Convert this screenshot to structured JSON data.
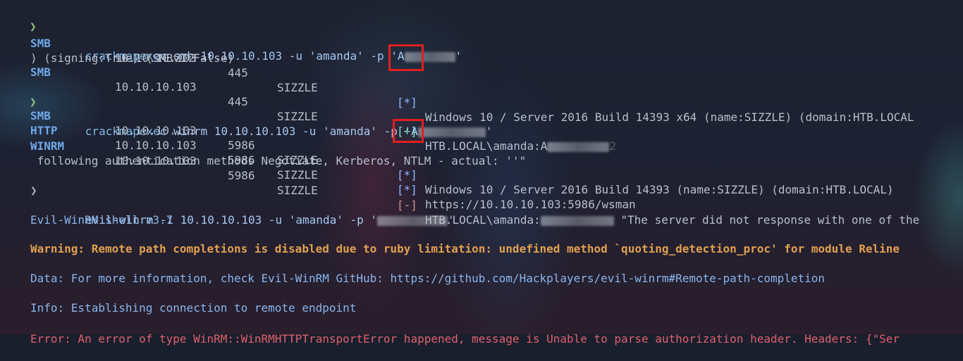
{
  "terminal": {
    "prompt_symbol": "❯",
    "blocks": {
      "smb_cmd": {
        "prog": "crackmapexec",
        "rest": " smb 10.10.10.103 -u 'amanda' -p 'A",
        "tail": "'"
      },
      "smb1": {
        "proto": "SMB",
        "ip": "10.10.10.103",
        "port": "445",
        "host": "SIZZLE",
        "status": "[*]",
        "msg": "Windows 10 / Server 2016 Build 14393 x64 (name:SIZZLE) (domain:HTB.LOCAL"
      },
      "smb1_wrap": ") (signing:True) (SMBv1:False)",
      "smb2": {
        "proto": "SMB",
        "ip": "10.10.10.103",
        "port": "445",
        "host": "SIZZLE",
        "status": "[+]",
        "msg": "HTB.LOCAL\\amanda:A",
        "tail": "2"
      },
      "winrm_cmd": {
        "prog": "crackmapexec",
        "rest": " winrm 10.10.10.103 -u 'amanda' -p 'A",
        "tail": "'"
      },
      "winrm1": {
        "proto": "SMB",
        "ip": "10.10.10.103",
        "port": "5986",
        "host": "SIZZLE",
        "status": "[*]",
        "msg": "Windows 10 / Server 2016 Build 14393 (name:SIZZLE) (domain:HTB.LOCAL)"
      },
      "winrm2": {
        "proto": "HTTP",
        "ip": "10.10.10.103",
        "port": "5986",
        "host": "SIZZLE",
        "status": "[*]",
        "msg": "https://10.10.10.103:5986/wsman"
      },
      "winrm3": {
        "proto": "WINRM",
        "ip": "10.10.10.103",
        "port": "5986",
        "host": "SIZZLE",
        "status": "[-]",
        "msg": "HTB.LOCAL\\amanda:",
        "msg2": " \"The server did not response with one of the"
      },
      "winrm3_wrap": " following authentication methods Negotiate, Kerberos, NTLM - actual: ''\"",
      "evil_cmd": {
        "prog": "evil-winrm",
        "rest": " -i 10.10.10.103 -u 'amanda' -p '",
        "tail": "'"
      },
      "evil_banner": "Evil-WinRM shell v3.7",
      "warning": "Warning: Remote path completions is disabled due to ruby limitation: undefined method `quoting_detection_proc' for module Reline",
      "data_line": "Data: For more information, check Evil-WinRM GitHub: https://github.com/Hackplayers/evil-winrm#Remote-path-completion",
      "info_line": "Info: Establishing connection to remote endpoint",
      "error_line": "Error: An error of type WinRM::WinRMHTTPTransportError happened, message is Unable to parse authorization header. Headers: {\"Ser"
    }
  },
  "colors": {
    "highlight_box": "#e02020",
    "warning": "#e0a050",
    "error": "#e0606a"
  }
}
